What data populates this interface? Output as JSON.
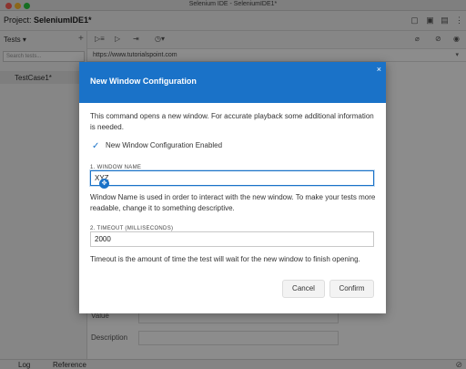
{
  "window": {
    "title": "Selenium IDE - SeleniumIDE1*"
  },
  "project": {
    "label": "Project:",
    "name": "SeleniumIDE1*"
  },
  "sidebar": {
    "tests_label": "Tests",
    "search_placeholder": "Search tests...",
    "items": [
      {
        "label": "TestCase1*"
      }
    ]
  },
  "main": {
    "url": "https://www.tutorialspoint.com",
    "rows": [
      {
        "label": "Value"
      },
      {
        "label": "Description"
      }
    ]
  },
  "bottom": {
    "tabs": [
      {
        "label": "Log"
      },
      {
        "label": "Reference"
      }
    ]
  },
  "dialog": {
    "title": "New Window Configuration",
    "description": "This command opens a new window. For accurate playback some additional information is needed.",
    "enabled_label": "New Window Configuration Enabled",
    "enabled": true,
    "window_name": {
      "label": "1. WINDOW NAME",
      "value": "XYZ",
      "help": "Window Name is used in order to interact with the new window. To make your tests more readable, change it to something descriptive."
    },
    "timeout": {
      "label": "2. TIMEOUT (MILLISECONDS)",
      "value": "2000",
      "help": "Timeout is the amount of time the test will wait for the new window to finish opening."
    },
    "cancel_label": "Cancel",
    "confirm_label": "Confirm",
    "close_icon": "×"
  },
  "colors": {
    "accent": "#1a72c8"
  }
}
